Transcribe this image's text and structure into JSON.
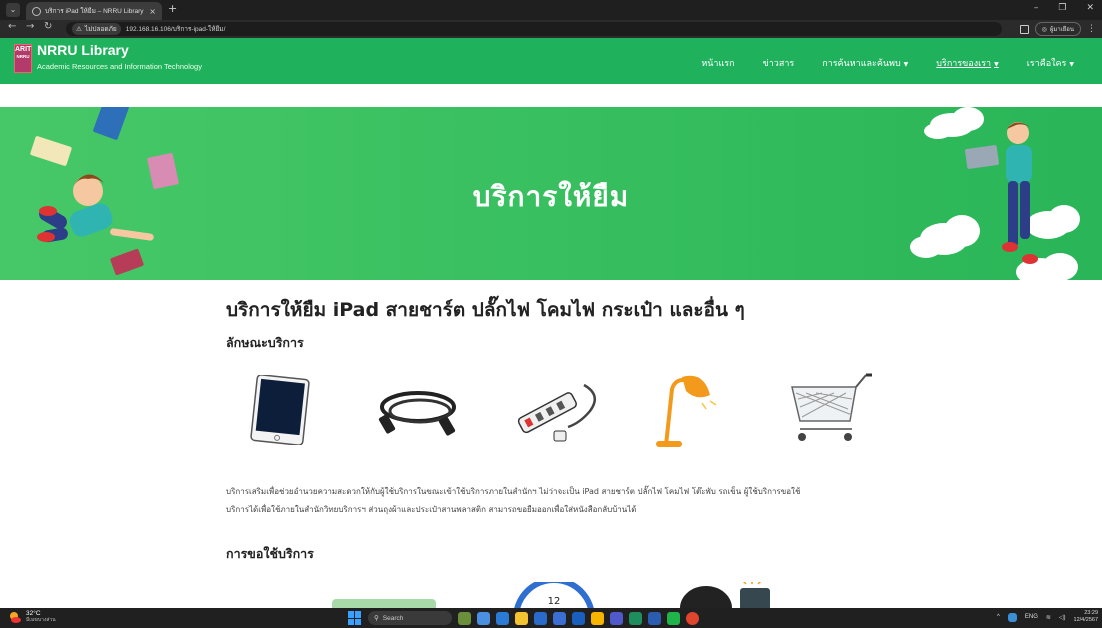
{
  "browser": {
    "tab_title": "บริการ iPad ให้ยืม – NRRU Library",
    "tab_close": "×",
    "new_tab": "+",
    "security_label": "ไม่ปลอดภัย",
    "url": "192.168.16.106/บริการ-ipad-ให้ยืม/",
    "profile_label": "ผู้มาเยือน"
  },
  "header": {
    "logo_top": "ARIT",
    "logo_bottom": "NRRU",
    "title": "NRRU Library",
    "subtitle": "Academic Resources and Information Technology",
    "nav": [
      {
        "label": "หน้าแรก"
      },
      {
        "label": "ข่าวสาร"
      },
      {
        "label": "การค้นหาและค้นพบ"
      },
      {
        "label": "บริการของเรา"
      },
      {
        "label": "เราคือใคร"
      }
    ]
  },
  "hero": {
    "title": "บริการให้ยืม"
  },
  "main": {
    "title": "บริการให้ยืม iPad สายชาร์ต ปลั๊กไฟ โคมไฟ กระเป๋า และอื่น ๆ",
    "section_heading": "ลักษณะบริการ",
    "description_line1": "บริการเสริมเพื่อช่วยอำนวยความสะดวกให้กับผู้ใช้บริการในขณะเข้าใช้บริการภายในสำนักฯ ไม่ว่าจะเป็น iPad สายชาร์ต ปลั๊กไฟ โคมไฟ โต๊ะพับ รถเข็น ผู้ใช้บริการขอใช้",
    "description_line2": "บริการได้เพื่อใช้ภายในสำนักวิทยบริการฯ ส่วนถุงผ้าและประเป๋าสานพลาสติก สามารถขอยืมออกเพื่อใส่หนังสือกลับบ้านได้",
    "usage_heading": "การขอใช้บริการ",
    "clock_number": "12"
  },
  "taskbar": {
    "temperature": "32°C",
    "weather_text": "มีเมฆบางส่วน",
    "search_placeholder": "Search",
    "lang": "ENG",
    "time": "23:29",
    "date": "12/4/2567"
  },
  "colors": {
    "header_green": "#20b15d",
    "hero_green": "#38bf5f"
  }
}
